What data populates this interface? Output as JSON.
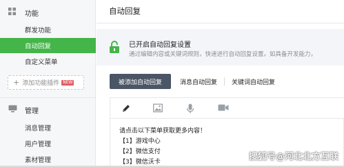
{
  "sidebar": {
    "section_features": {
      "label": "功能",
      "icon": "grid-icon"
    },
    "items_top": [
      {
        "label": "群发功能",
        "active": false
      },
      {
        "label": "自动回复",
        "active": true
      },
      {
        "label": "自定义菜单",
        "active": false
      }
    ],
    "add_plugin": {
      "label": "添加功能插件",
      "badge": "NEW"
    },
    "section_manage": {
      "label": "管理",
      "icon": "monitor-icon"
    },
    "items_manage": [
      {
        "label": "消息管理"
      },
      {
        "label": "用户管理"
      },
      {
        "label": "素材管理"
      }
    ]
  },
  "main": {
    "page_title": "自动回复",
    "status": {
      "title": "已开启自动回复设置",
      "description": "通过编辑内容或关键词规则，快速进行自动回复设置。如具备开发能力，"
    },
    "tabs": [
      {
        "label": "被添加自动回复",
        "active": true
      },
      {
        "label": "消息自动回复",
        "active": false
      },
      {
        "label": "关键词自动回复",
        "active": false
      }
    ],
    "editor": {
      "tools": [
        "pencil-icon",
        "image-icon",
        "microphone-icon",
        "video-icon"
      ],
      "lines": [
        "请点击以下菜单获取更多内容！",
        "【1】游戏中心",
        "【2】微信支付",
        "【3】微信沃卡"
      ]
    }
  },
  "watermark": "搜狐号@河北北方互联",
  "colors": {
    "accent": "#44b549",
    "tab_active": "#4a5565",
    "status_bg": "#f4f5f9"
  }
}
